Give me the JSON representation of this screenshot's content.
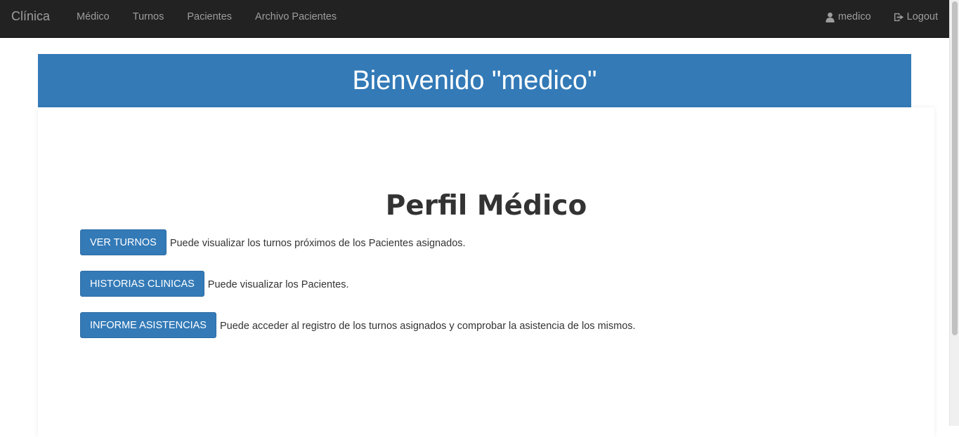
{
  "navbar": {
    "brand": "Clínica",
    "links": [
      "Médico",
      "Turnos",
      "Pacientes",
      "Archivo Pacientes"
    ],
    "user_label": "medico",
    "logout_label": "Logout"
  },
  "banner": {
    "title": "Bienvenido \"medico\""
  },
  "main": {
    "title": "Perfil Médico",
    "actions": [
      {
        "label": "VER TURNOS",
        "description": "Puede visualizar los turnos próximos de los Pacientes asignados."
      },
      {
        "label": "HISTORIAS CLINICAS",
        "description": "Puede visualizar los Pacientes."
      },
      {
        "label": "INFORME ASISTENCIAS",
        "description": "Puede acceder al registro de los turnos asignados y comprobar la asistencia de los mismos."
      }
    ]
  },
  "colors": {
    "navbar_bg": "#222222",
    "nav_text": "#9d9d9d",
    "primary": "#337ab7"
  },
  "icons": {
    "user": "user-icon",
    "logout": "logout-icon"
  }
}
